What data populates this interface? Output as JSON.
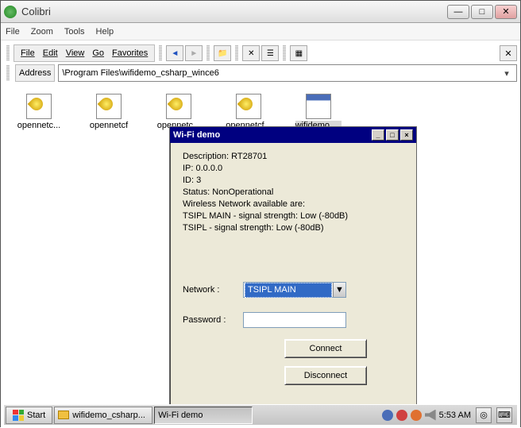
{
  "window": {
    "title": "Colibri"
  },
  "menubar": {
    "file": "File",
    "zoom": "Zoom",
    "tools": "Tools",
    "help": "Help"
  },
  "toolbar": {
    "file": "File",
    "edit": "Edit",
    "view": "View",
    "go": "Go",
    "favorites": "Favorites"
  },
  "address": {
    "label": "Address",
    "value": "\\Program Files\\wifidemo_csharp_wince6"
  },
  "files": [
    {
      "label": "opennetc..."
    },
    {
      "label": "opennetcf"
    },
    {
      "label": "opennetc..."
    },
    {
      "label": "opennetcf..."
    },
    {
      "label": "wifidemo_...",
      "selected": true,
      "type": "exe"
    }
  ],
  "wifi": {
    "title": "Wi-Fi demo",
    "info": {
      "description": "Description: RT28701",
      "ip": "IP: 0.0.0.0",
      "id": "ID: 3",
      "status": "Status: NonOperational",
      "available": "Wireless Network available are:",
      "net1": "TSIPL MAIN -  signal strength: Low (-80dB)",
      "net2": "TSIPL -  signal strength: Low (-80dB)"
    },
    "network_label": "Network  :",
    "network_value": "TSIPL MAIN",
    "password_label": "Password  :",
    "connect": "Connect",
    "disconnect": "Disconnect"
  },
  "taskbar": {
    "start": "Start",
    "task1": "wifidemo_csharp...",
    "task2": "Wi-Fi demo",
    "time": "5:53 AM"
  }
}
